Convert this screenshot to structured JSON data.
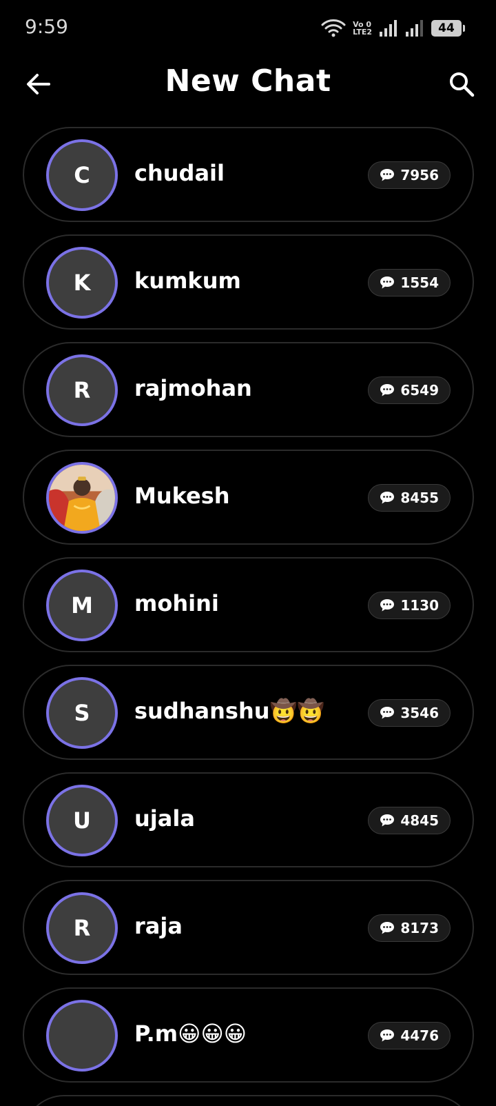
{
  "status_bar": {
    "time": "9:59",
    "volte_top": "Vo 0",
    "volte_bottom": "LTE2",
    "battery": "44"
  },
  "header": {
    "title": "New Chat",
    "back_icon": "arrow-left-icon",
    "search_icon": "search-icon"
  },
  "colors": {
    "background": "#000000",
    "avatar_ring": "#7b72e6",
    "avatar_fill": "#3e3e3e",
    "card_border": "#2b2b2b"
  },
  "chats": [
    {
      "initial": "C",
      "name": "chudail",
      "count": "7956",
      "photo": false
    },
    {
      "initial": "K",
      "name": "kumkum",
      "count": "1554",
      "photo": false
    },
    {
      "initial": "R",
      "name": "rajmohan",
      "count": "6549",
      "photo": false
    },
    {
      "initial": "",
      "name": "Mukesh",
      "count": "8455",
      "photo": true
    },
    {
      "initial": "M",
      "name": "mohini",
      "count": "1130",
      "photo": false
    },
    {
      "initial": "S",
      "name": "sudhanshu🤠🤠",
      "count": "3546",
      "photo": false
    },
    {
      "initial": "U",
      "name": "ujala",
      "count": "4845",
      "photo": false
    },
    {
      "initial": "R",
      "name": "raja",
      "count": "8173",
      "photo": false
    },
    {
      "initial": "",
      "name": "P.m😀😀😀",
      "count": "4476",
      "photo": false
    }
  ]
}
